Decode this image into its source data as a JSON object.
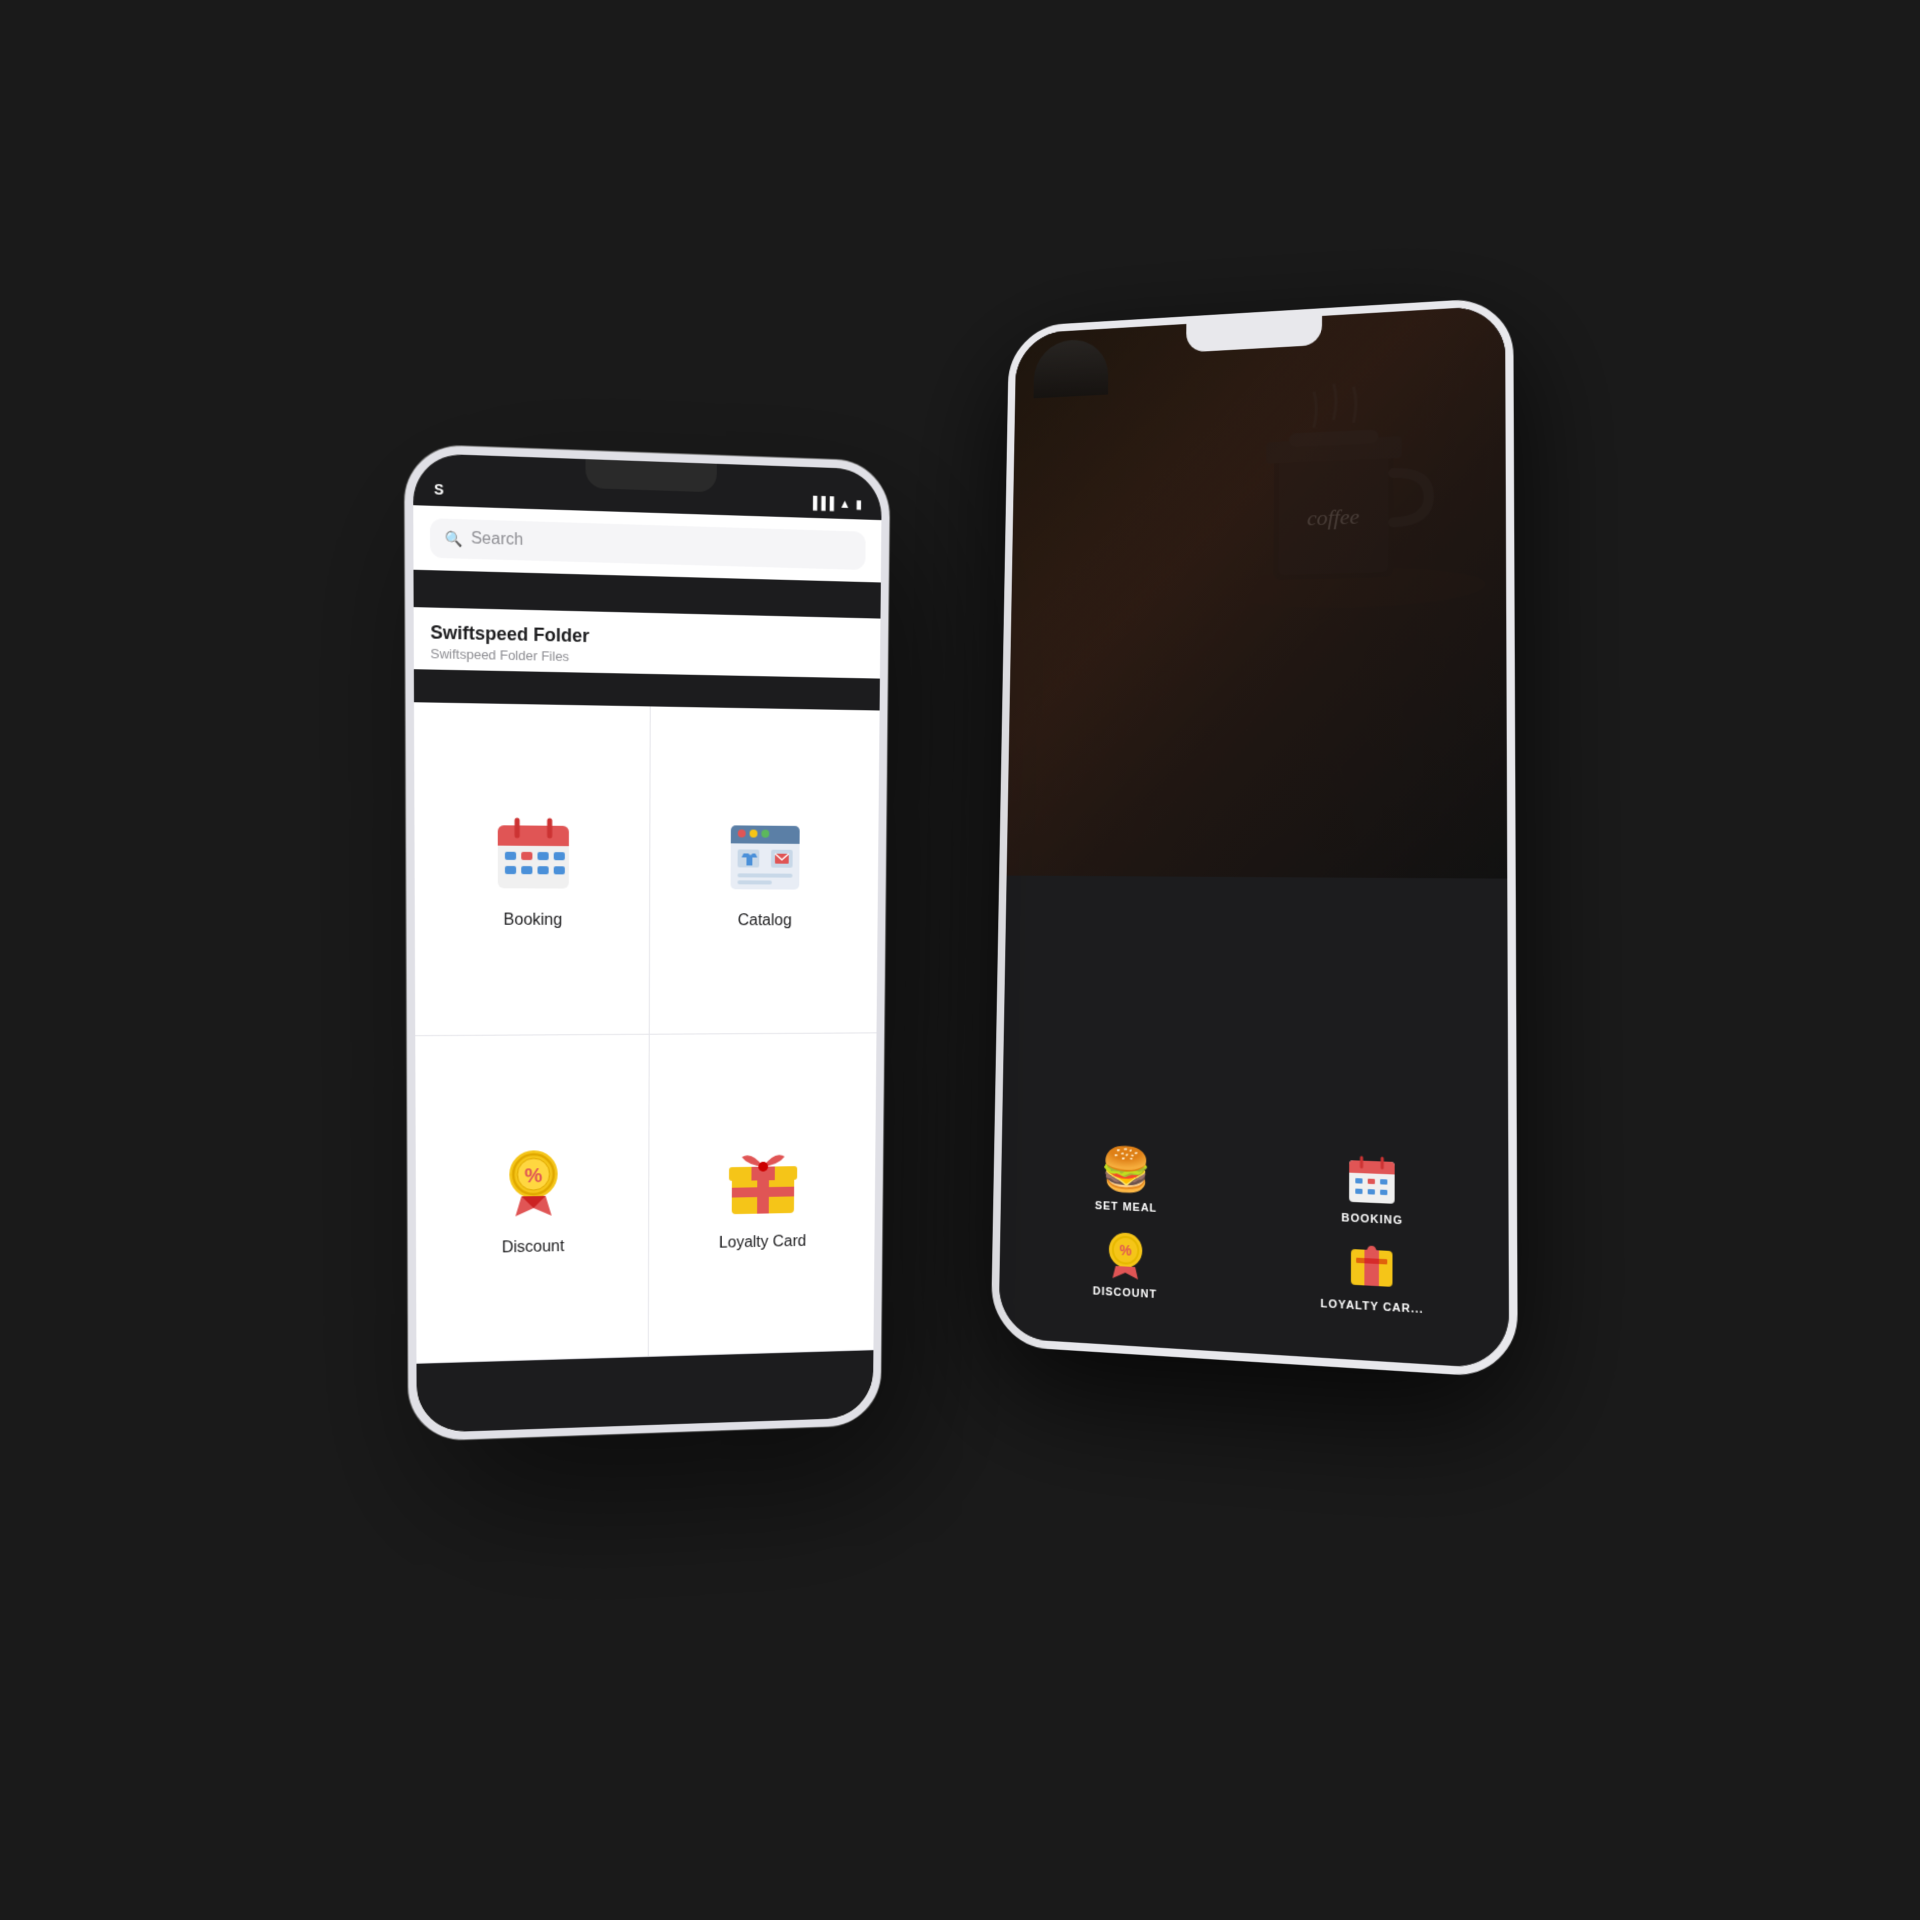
{
  "scene": {
    "background": "#1a1a1a"
  },
  "front_phone": {
    "status_bar": {
      "time": "S",
      "icons": [
        "▶",
        "●●",
        "■"
      ]
    },
    "search": {
      "placeholder": "Search"
    },
    "folder": {
      "title": "Swiftspeed Folder",
      "subtitle": "Swiftspeed Folder Files"
    },
    "apps": [
      {
        "id": "booking",
        "label": "Booking",
        "icon": "booking"
      },
      {
        "id": "catalog",
        "label": "Catalog",
        "icon": "catalog"
      },
      {
        "id": "discount",
        "label": "Discount",
        "icon": "discount"
      },
      {
        "id": "loyalty",
        "label": "Loyalty Card",
        "icon": "loyalty"
      }
    ]
  },
  "back_phone": {
    "apps": [
      {
        "id": "set-meal",
        "label": "SET MEAL",
        "icon": "🍔"
      },
      {
        "id": "booking-back",
        "label": "BOOKING",
        "icon": "booking"
      },
      {
        "id": "discount-back",
        "label": "DISCOUNT",
        "icon": "discount"
      },
      {
        "id": "loyalty-back",
        "label": "LOYALTY CAR...",
        "icon": "loyalty"
      }
    ],
    "coffee_text": "coffee"
  }
}
